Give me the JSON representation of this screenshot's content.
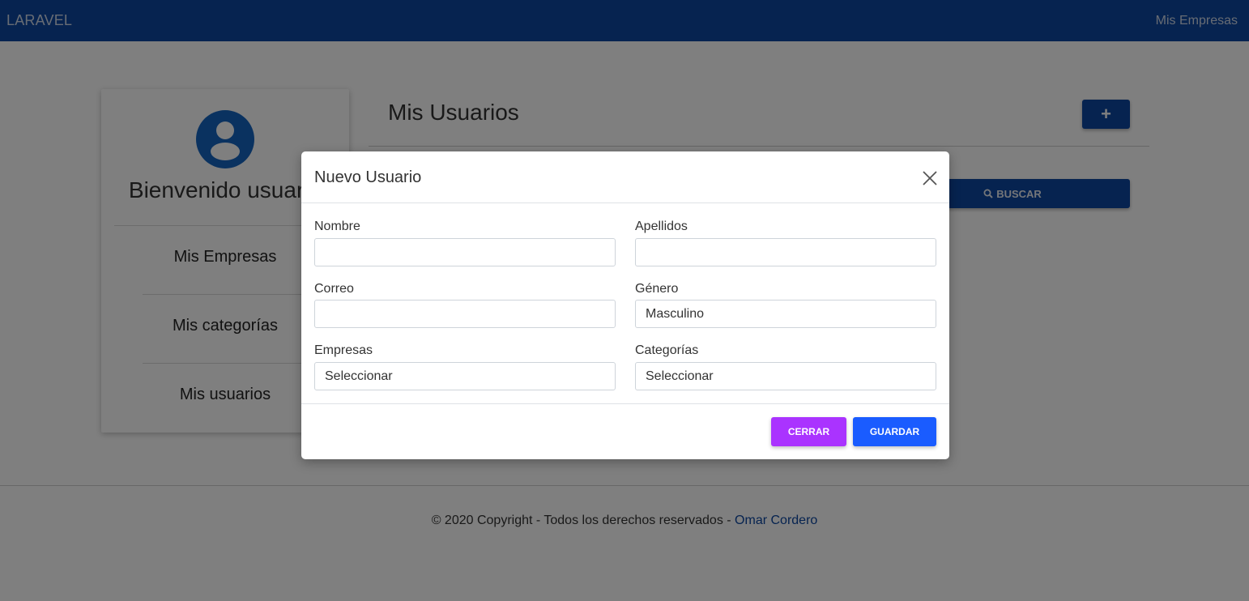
{
  "navbar": {
    "brand": "LARAVEL",
    "link": "Mis Empresas"
  },
  "sidebar": {
    "welcome": "Bienvenido usuario",
    "items": [
      {
        "label": "Mis Empresas"
      },
      {
        "label": "Mis categorías"
      },
      {
        "label": "Mis usuarios"
      }
    ]
  },
  "main": {
    "title": "Mis Usuarios",
    "add_label": "+",
    "search_label": "BUSCAR"
  },
  "footer": {
    "text": "© 2020 Copyright - Todos los derechos reservados - ",
    "author": "Omar Cordero"
  },
  "modal": {
    "title": "Nuevo Usuario",
    "fields": {
      "nombre": {
        "label": "Nombre",
        "value": ""
      },
      "apellidos": {
        "label": "Apellidos",
        "value": ""
      },
      "correo": {
        "label": "Correo",
        "value": ""
      },
      "genero": {
        "label": "Género",
        "value": "Masculino"
      },
      "empresas": {
        "label": "Empresas",
        "value": "Seleccionar"
      },
      "categorias": {
        "label": "Categorías",
        "value": "Seleccionar"
      }
    },
    "close_label": "CERRAR",
    "save_label": "GUARDAR"
  },
  "colors": {
    "navbar": "#0d47a1",
    "primary": "#1a5cff",
    "close_button": "#aa33ff"
  }
}
